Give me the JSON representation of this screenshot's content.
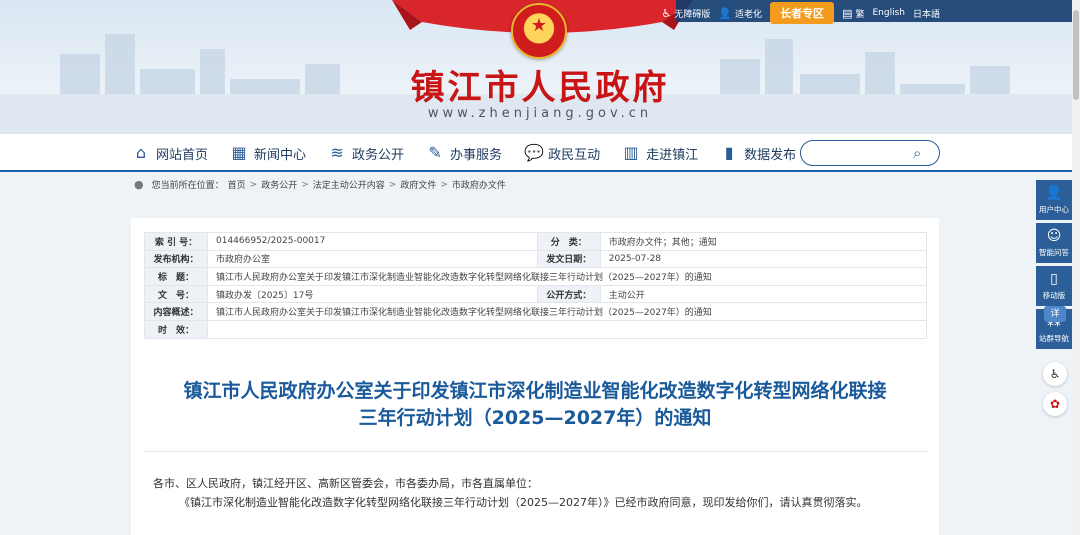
{
  "header": {
    "title": "镇江市人民政府",
    "url": "www.zhenjiang.gov.cn",
    "tools": {
      "accessibility": "无障碍版",
      "elderly": "适老化",
      "elder_zone": "长者专区",
      "traditional": "繁",
      "english": "English",
      "japanese": "日本語"
    }
  },
  "nav": {
    "items": [
      {
        "label": "网站首页",
        "icon": "home-icon"
      },
      {
        "label": "新闻中心",
        "icon": "news-icon"
      },
      {
        "label": "政务公开",
        "icon": "layers-icon"
      },
      {
        "label": "办事服务",
        "icon": "edit-icon"
      },
      {
        "label": "政民互动",
        "icon": "chat-icon"
      },
      {
        "label": "走进镇江",
        "icon": "building-icon"
      },
      {
        "label": "数据发布",
        "icon": "data-icon"
      }
    ],
    "search_placeholder": ""
  },
  "breadcrumb": {
    "prefix": "您当前所在位置：",
    "items": [
      "首页",
      "政务公开",
      "法定主动公开内容",
      "政府文件",
      "市政府办文件"
    ]
  },
  "meta": {
    "index_key": "索 引 号：",
    "index_val": "014466952/2025-00017",
    "category_key": "分　类：",
    "category_val": "市政府办文件；其他；通知",
    "issuer_key": "发布机构：",
    "issuer_val": "市政府办公室",
    "date_key": "发文日期：",
    "date_val": "2025-07-28",
    "title_key": "标　题：",
    "title_val": "镇江市人民政府办公室关于印发镇江市深化制造业智能化改造数字化转型网络化联接三年行动计划（2025—2027年）的通知",
    "docno_key": "文　号：",
    "docno_val": "镇政办发〔2025〕17号",
    "method_key": "公开方式：",
    "method_val": "主动公开",
    "summary_key": "内容概述：",
    "summary_val": "镇江市人民政府办公室关于印发镇江市深化制造业智能化改造数字化转型网络化联接三年行动计划（2025—2027年）的通知",
    "valid_key": "时　效：",
    "valid_val": ""
  },
  "doc": {
    "title_line1": "镇江市人民政府办公室关于印发镇江市深化制造业智能化改造数字化转型网络化联接",
    "title_line2": "三年行动计划（2025—2027年）的通知",
    "salute": "各市、区人民政府，镇江经开区、高新区管委会，市各委办局，市各直属单位：",
    "para1": "《镇江市深化制造业智能化改造数字化转型网络化联接三年行动计划（2025—2027年）》已经市政府同意，现印发给你们，请认真贯彻落实。"
  },
  "float": {
    "user_center": "用户中心",
    "smart_qa": "智能问答",
    "mobile": "移动版",
    "site_nav": "站群导航",
    "detail": "详"
  }
}
